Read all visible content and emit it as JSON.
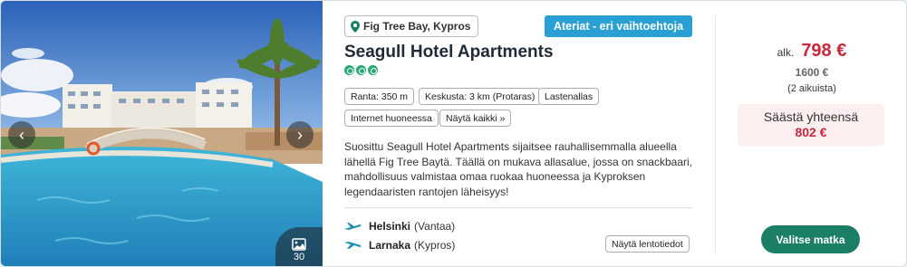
{
  "gallery": {
    "count": "30"
  },
  "hotel": {
    "location": "Fig Tree Bay, Kypros",
    "meal_option": "Ateriat - eri vaihtoehtoja",
    "name": "Seagull Hotel Apartments",
    "rating_count": 3,
    "tags": [
      "Ranta: 350 m",
      "Keskusta: 3 km (Protaras)",
      "Lastenallas",
      "Internet huoneessa",
      "Näytä kaikki »"
    ],
    "description": "Suosittu Seagull Hotel Apartments sijaitsee rauhallisemmalla alueella lähellä Fig Tree Baytä. Täällä on mukava allasalue, jossa on snackbaari, mahdollisuus valmistaa omaa ruokaa huoneessa ja Kyproksen legendaaristen rantojen läheisyys!"
  },
  "flights": {
    "departure_city": "Helsinki",
    "departure_airport": "(Vantaa)",
    "arrival_city": "Larnaka",
    "arrival_country": "(Kypros)",
    "details_button": "Näytä lentotiedot"
  },
  "price": {
    "prefix": "alk.",
    "current": "798 €",
    "original": "1600 €",
    "per": "(2 aikuista)",
    "save_label": "Säästä yhteensä",
    "save_amount": "802 €",
    "select_button": "Valitse matka"
  },
  "colors": {
    "accent_blue": "#2a9fd4",
    "price_red": "#c8283a",
    "button_green": "#1a7f64",
    "rating_green": "#2aa876"
  }
}
